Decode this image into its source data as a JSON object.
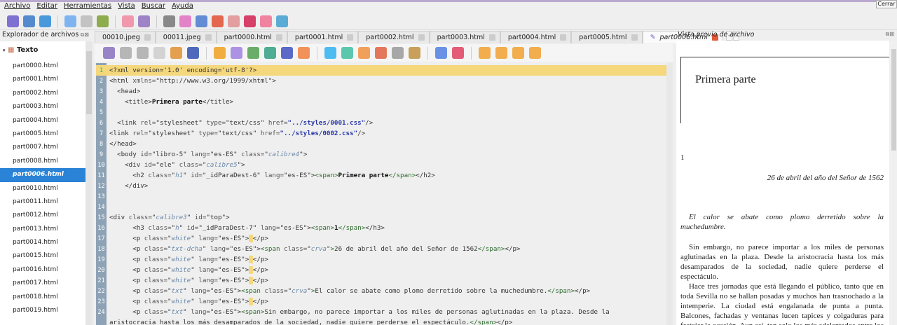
{
  "menu": [
    "Archivo",
    "Editar",
    "Herramientas",
    "Vista",
    "Buscar",
    "Ayuda"
  ],
  "close_label": "Cerrar",
  "sidebar": {
    "title": "Explorador de archivos",
    "root": "Texto",
    "files": [
      "part0000.html",
      "part0001.html",
      "part0002.html",
      "part0003.html",
      "part0004.html",
      "part0005.html",
      "part0007.html",
      "part0008.html",
      "part0006.html",
      "part0010.html",
      "part0011.html",
      "part0012.html",
      "part0013.html",
      "part0014.html",
      "part0015.html",
      "part0016.html",
      "part0017.html",
      "part0018.html",
      "part0019.html"
    ],
    "selected": "part0006.html"
  },
  "tabs": [
    {
      "label": "00010.jpeg"
    },
    {
      "label": "00011.jpeg"
    },
    {
      "label": "part0000.html"
    },
    {
      "label": "part0001.html"
    },
    {
      "label": "part0002.html"
    },
    {
      "label": "part0003.html"
    },
    {
      "label": "part0004.html"
    },
    {
      "label": "part0005.html"
    },
    {
      "label": "part0006.html",
      "active": true
    }
  ],
  "code": [
    [
      [
        "t",
        "<?xml version='1.0' encoding='utf-8'?>"
      ]
    ],
    [
      [
        "t",
        "<html "
      ],
      [
        "a",
        "xmlns="
      ],
      [
        "v",
        "\"http://www.w3.org/1999/xhtml\""
      ],
      [
        "t",
        ">"
      ]
    ],
    [
      [
        "t",
        "  <head>"
      ]
    ],
    [
      [
        "t",
        "    <title>"
      ],
      [
        "b",
        "Primera parte"
      ],
      [
        "t",
        "</title>"
      ]
    ],
    [],
    [
      [
        "t",
        "  <link "
      ],
      [
        "a",
        "rel="
      ],
      [
        "v",
        "\"stylesheet\" "
      ],
      [
        "a",
        "type="
      ],
      [
        "v",
        "\"text/css\" "
      ],
      [
        "a",
        "href="
      ],
      [
        "h",
        "\"../styles/0001.css\""
      ],
      [
        "t",
        "/>"
      ]
    ],
    [
      [
        "t",
        "<link "
      ],
      [
        "a",
        "rel="
      ],
      [
        "v",
        "\"stylesheet\" "
      ],
      [
        "a",
        "type="
      ],
      [
        "v",
        "\"text/css\" "
      ],
      [
        "a",
        "href="
      ],
      [
        "h",
        "\"../styles/0002.css\""
      ],
      [
        "t",
        "/>"
      ]
    ],
    [
      [
        "t",
        "</head>"
      ]
    ],
    [
      [
        "t",
        "  <body "
      ],
      [
        "a",
        "id="
      ],
      [
        "v",
        "\"libro-5\" "
      ],
      [
        "a",
        "lang="
      ],
      [
        "v",
        "\"es-ES\" "
      ],
      [
        "a",
        "class="
      ],
      [
        "v",
        "\""
      ],
      [
        "k",
        "calibre4"
      ],
      [
        "v",
        "\""
      ],
      [
        "t",
        ">"
      ]
    ],
    [
      [
        "t",
        "    <div "
      ],
      [
        "a",
        "id="
      ],
      [
        "v",
        "\"ele\" "
      ],
      [
        "a",
        "class="
      ],
      [
        "v",
        "\""
      ],
      [
        "k",
        "calibre5"
      ],
      [
        "v",
        "\""
      ],
      [
        "t",
        ">"
      ]
    ],
    [
      [
        "t",
        "      <h2 "
      ],
      [
        "a",
        "class="
      ],
      [
        "v",
        "\""
      ],
      [
        "k",
        "h1"
      ],
      [
        "v",
        "\" "
      ],
      [
        "a",
        "id="
      ],
      [
        "v",
        "\"_idParaDest-6\" "
      ],
      [
        "a",
        "lang="
      ],
      [
        "v",
        "\"es-ES\""
      ],
      [
        "t",
        ">"
      ],
      [
        "s",
        "<span>"
      ],
      [
        "b",
        "Primera parte"
      ],
      [
        "s",
        "</span>"
      ],
      [
        "t",
        "</h2>"
      ]
    ],
    [
      [
        "t",
        "    </div>"
      ]
    ],
    [],
    [],
    [
      [
        "t",
        "<div "
      ],
      [
        "a",
        "class="
      ],
      [
        "v",
        "\""
      ],
      [
        "k",
        "calibre3"
      ],
      [
        "v",
        "\" "
      ],
      [
        "a",
        "id="
      ],
      [
        "v",
        "\"top\""
      ],
      [
        "t",
        ">"
      ]
    ],
    [
      [
        "t",
        "      <h3 "
      ],
      [
        "a",
        "class="
      ],
      [
        "v",
        "\""
      ],
      [
        "k",
        "h"
      ],
      [
        "v",
        "\" "
      ],
      [
        "a",
        "id="
      ],
      [
        "v",
        "\"_idParaDest-7\" "
      ],
      [
        "a",
        "lang="
      ],
      [
        "v",
        "\"es-ES\""
      ],
      [
        "t",
        ">"
      ],
      [
        "s",
        "<span>"
      ],
      [
        "b",
        "1"
      ],
      [
        "s",
        "</span>"
      ],
      [
        "t",
        "</h3>"
      ]
    ],
    [
      [
        "t",
        "      <p "
      ],
      [
        "a",
        "class="
      ],
      [
        "v",
        "\""
      ],
      [
        "k",
        "white"
      ],
      [
        "v",
        "\" "
      ],
      [
        "a",
        "lang="
      ],
      [
        "v",
        "\"es-ES\""
      ],
      [
        "t",
        ">"
      ],
      [
        "mk",
        " "
      ],
      [
        "t",
        "</p>"
      ]
    ],
    [
      [
        "t",
        "      <p "
      ],
      [
        "a",
        "class="
      ],
      [
        "v",
        "\""
      ],
      [
        "k",
        "txt-dcha"
      ],
      [
        "v",
        "\" "
      ],
      [
        "a",
        "lang="
      ],
      [
        "v",
        "\"es-ES\""
      ],
      [
        "t",
        ">"
      ],
      [
        "s",
        "<span "
      ],
      [
        "a",
        "class="
      ],
      [
        "v",
        "\""
      ],
      [
        "k",
        "crva"
      ],
      [
        "v",
        "\""
      ],
      [
        "s",
        ">"
      ],
      [
        "t",
        "26 de abril del año del Señor de 1562"
      ],
      [
        "s",
        "</span>"
      ],
      [
        "t",
        "</p>"
      ]
    ],
    [
      [
        "t",
        "      <p "
      ],
      [
        "a",
        "class="
      ],
      [
        "v",
        "\""
      ],
      [
        "k",
        "white"
      ],
      [
        "v",
        "\" "
      ],
      [
        "a",
        "lang="
      ],
      [
        "v",
        "\"es-ES\""
      ],
      [
        "t",
        ">"
      ],
      [
        "mk",
        " "
      ],
      [
        "t",
        "</p>"
      ]
    ],
    [
      [
        "t",
        "      <p "
      ],
      [
        "a",
        "class="
      ],
      [
        "v",
        "\""
      ],
      [
        "k",
        "white"
      ],
      [
        "v",
        "\" "
      ],
      [
        "a",
        "lang="
      ],
      [
        "v",
        "\"es-ES\""
      ],
      [
        "t",
        ">"
      ],
      [
        "mk",
        " "
      ],
      [
        "t",
        "</p>"
      ]
    ],
    [
      [
        "t",
        "      <p "
      ],
      [
        "a",
        "class="
      ],
      [
        "v",
        "\""
      ],
      [
        "k",
        "white"
      ],
      [
        "v",
        "\" "
      ],
      [
        "a",
        "lang="
      ],
      [
        "v",
        "\"es-ES\""
      ],
      [
        "t",
        ">"
      ],
      [
        "mk",
        " "
      ],
      [
        "t",
        "</p>"
      ]
    ],
    [
      [
        "t",
        "      <p "
      ],
      [
        "a",
        "class="
      ],
      [
        "v",
        "\""
      ],
      [
        "k",
        "txt"
      ],
      [
        "v",
        "\" "
      ],
      [
        "a",
        "lang="
      ],
      [
        "v",
        "\"es-ES\""
      ],
      [
        "t",
        ">"
      ],
      [
        "s",
        "<span "
      ],
      [
        "a",
        "class="
      ],
      [
        "v",
        "\""
      ],
      [
        "k",
        "crva"
      ],
      [
        "v",
        "\""
      ],
      [
        "s",
        ">"
      ],
      [
        "t",
        "El calor se abate como plomo derretido sobre la muchedumbre."
      ],
      [
        "s",
        "</span>"
      ],
      [
        "t",
        "</p>"
      ]
    ],
    [
      [
        "t",
        "      <p "
      ],
      [
        "a",
        "class="
      ],
      [
        "v",
        "\""
      ],
      [
        "k",
        "white"
      ],
      [
        "v",
        "\" "
      ],
      [
        "a",
        "lang="
      ],
      [
        "v",
        "\"es-ES\""
      ],
      [
        "t",
        ">"
      ],
      [
        "mk",
        " "
      ],
      [
        "t",
        "</p>"
      ]
    ],
    [
      [
        "t",
        "      <p "
      ],
      [
        "a",
        "class="
      ],
      [
        "v",
        "\""
      ],
      [
        "k",
        "txt"
      ],
      [
        "v",
        "\" "
      ],
      [
        "a",
        "lang="
      ],
      [
        "v",
        "\"es-ES\""
      ],
      [
        "t",
        ">"
      ],
      [
        "s",
        "<span>"
      ],
      [
        "t",
        "Sin embargo, no parece importar a los miles de personas aglutinadas en la plaza. Desde la"
      ]
    ],
    [
      [
        "t",
        "aristocracia hasta los más desamparados de la sociedad, nadie quiere perderse el espectáculo."
      ],
      [
        "s",
        "</span>"
      ],
      [
        "t",
        "</p>"
      ]
    ]
  ],
  "preview": {
    "title": "Vista previo de archivo",
    "heading": "Primera parte",
    "number": "1",
    "date": "26 de abril del año del Señor de 1562",
    "p1": "El calor se abate como plomo derretido sobre la muchedumbre.",
    "p2": "Sin embargo, no parece importar a los miles de personas aglutinadas en la plaza. Desde la aristocracia hasta los más desamparados de la sociedad, nadie quiere perderse el espectáculo.",
    "p3": "Hace tres jornadas que está llegando el público, tanto que en toda Sevilla no se hallan posadas y muchos han trasnochado a la intemperie. La ciudad está engalanada de punta a punta. Balcones, fachadas y ventanas lucen tapices y colgaduras para festejar la ocasión. Aun así, tan solo los más adelantados entre los mecheros han logrado un buen sitio en"
  },
  "toolbar_icons": [
    [
      "new-book-icon",
      "#6a5acd"
    ],
    [
      "open-icon",
      "#3a78c8"
    ],
    [
      "save-icon",
      "#2a8ad8"
    ],
    [
      "back-icon",
      "#6aaaf0"
    ],
    [
      "forward-icon",
      "#bbbbbb"
    ],
    [
      "pin-icon",
      "#7aa030"
    ],
    [
      "heart-icon",
      "#f08aa0"
    ],
    [
      "book-icon",
      "#9070c0"
    ],
    [
      "spellcheck-icon",
      "#777"
    ],
    [
      "metadata-icon",
      "#e070c0"
    ],
    [
      "toc-icon",
      "#4a7ad0"
    ],
    [
      "regex-icon",
      "#e05030"
    ],
    [
      "font-icon",
      "#e09090"
    ],
    [
      "quote-icon",
      "#d02050"
    ],
    [
      "clip-icon",
      "#f07090"
    ],
    [
      "report-icon",
      "#40a0d0"
    ]
  ],
  "editor_icons": [
    [
      "undo-icon",
      "#8a70c0"
    ],
    [
      "redo-icon",
      "#aaa"
    ],
    [
      "cut-icon",
      "#aaa"
    ],
    [
      "copy-icon",
      "#ccc"
    ],
    [
      "paste-icon",
      "#e09030"
    ],
    [
      "comment-icon",
      "#3050b0"
    ],
    [
      "html-tag-icon",
      "#f0a020"
    ],
    [
      "settings-icon",
      "#a080e0"
    ],
    [
      "image-icon",
      "#50a050"
    ],
    [
      "link-icon",
      "#30a080"
    ],
    [
      "preview-icon",
      "#4050c0"
    ],
    [
      "heading-icon",
      "#f08040"
    ],
    [
      "bold-icon",
      "#30b0f0"
    ],
    [
      "italic-icon",
      "#40c0a0"
    ],
    [
      "underline-icon",
      "#f09040"
    ],
    [
      "strike-icon",
      "#e06040"
    ],
    [
      "subscript-icon",
      "#999"
    ],
    [
      "superscript-icon",
      "#c09040"
    ],
    [
      "clean-icon",
      "#5080e0"
    ],
    [
      "eraser-icon",
      "#e04060"
    ],
    [
      "align-left-icon",
      "#f0a030"
    ],
    [
      "align-center-icon",
      "#f0a030"
    ],
    [
      "align-right-icon",
      "#f0a030"
    ],
    [
      "justify-icon",
      "#f0a030"
    ]
  ]
}
